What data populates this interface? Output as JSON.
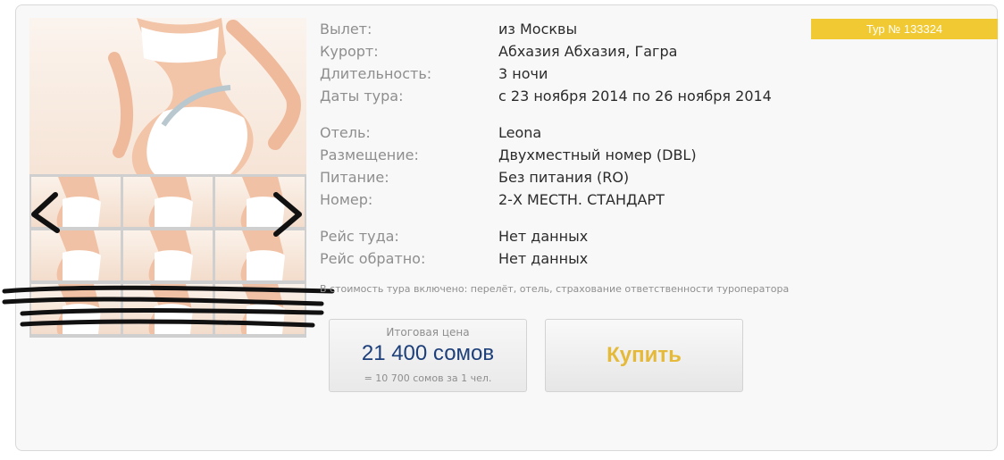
{
  "tour": {
    "number_label": "Тур № 133324"
  },
  "details": {
    "departure": {
      "label": "Вылет:",
      "value": "из Москвы"
    },
    "resort": {
      "label": "Курорт:",
      "value": "Абхазия Абхазия, Гагра"
    },
    "duration": {
      "label": "Длительность:",
      "value": "3 ночи"
    },
    "dates": {
      "label": "Даты тура:",
      "value": "с 23 ноября 2014 по 26 ноября 2014"
    },
    "hotel": {
      "label": "Отель:",
      "value": "Leona"
    },
    "accommodation": {
      "label": "Размещение:",
      "value": "Двухместный номер (DBL)"
    },
    "meals": {
      "label": "Питание:",
      "value": "Без питания (RO)"
    },
    "room": {
      "label": "Номер:",
      "value": "2-Х МЕСТН. СТАНДАРТ"
    },
    "flight_out": {
      "label": "Рейс туда:",
      "value": "Нет данных"
    },
    "flight_back": {
      "label": "Рейс обратно:",
      "value": "Нет данных"
    }
  },
  "note": "В стоимость тура включено: перелёт, отель, страхование ответственности туроператора",
  "price": {
    "caption": "Итоговая цена",
    "total": "21 400 сомов",
    "per_person": "= 10 700 сомов за 1 чел."
  },
  "buy_label": "Купить",
  "colors": {
    "badge": "#f1c932",
    "price": "#1d3f7a",
    "buy_text": "#e5b93a"
  },
  "gallery": {
    "prev_icon": "chevron-left-icon",
    "next_icon": "chevron-right-icon",
    "thumbnail_count": 9
  }
}
